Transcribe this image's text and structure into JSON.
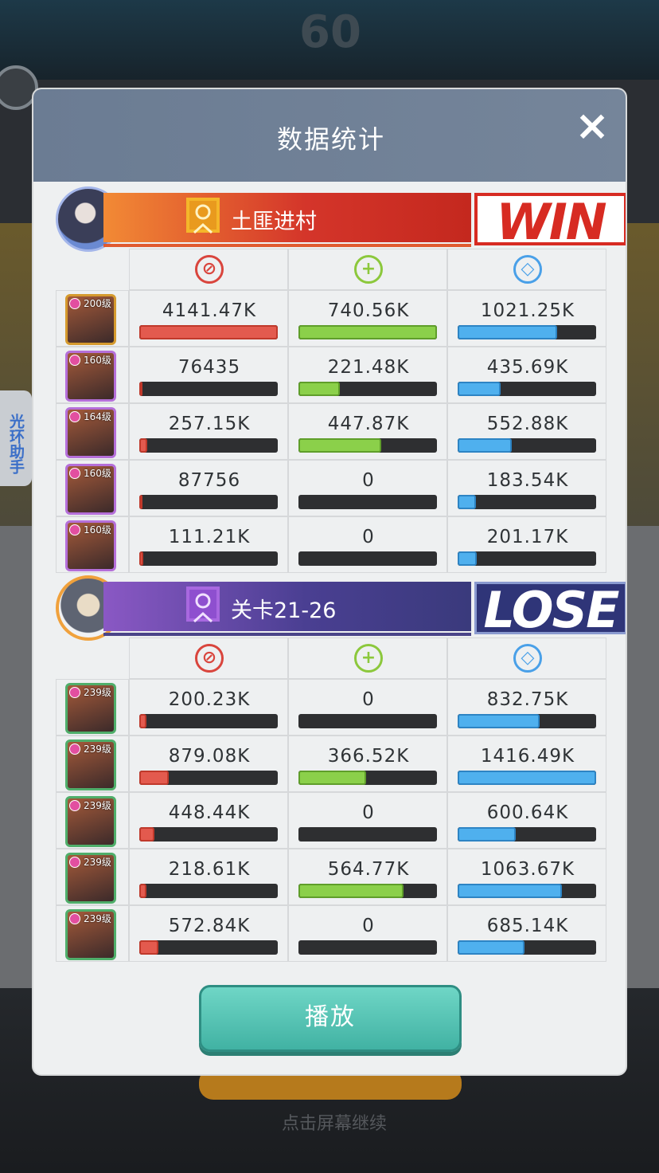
{
  "background": {
    "score": "60",
    "hint": "点击屏幕继续"
  },
  "side_tab": {
    "label": "光环助手"
  },
  "dialog": {
    "title": "数据统计",
    "close_icon": "×",
    "play_label": "播放"
  },
  "teams": [
    {
      "name": "土匪进村",
      "result": "WIN",
      "heroes": [
        {
          "level": "200级",
          "damage": "4141.47K",
          "damage_frac": 1.0,
          "heal": "740.56K",
          "heal_frac": 1.0,
          "shield": "1021.25K",
          "shield_frac": 0.72
        },
        {
          "level": "160级",
          "damage": "76435",
          "damage_frac": 0.02,
          "heal": "221.48K",
          "heal_frac": 0.3,
          "shield": "435.69K",
          "shield_frac": 0.31
        },
        {
          "level": "164级",
          "damage": "257.15K",
          "damage_frac": 0.06,
          "heal": "447.87K",
          "heal_frac": 0.6,
          "shield": "552.88K",
          "shield_frac": 0.39
        },
        {
          "level": "160级",
          "damage": "87756",
          "damage_frac": 0.02,
          "heal": "0",
          "heal_frac": 0,
          "shield": "183.54K",
          "shield_frac": 0.13
        },
        {
          "level": "160级",
          "damage": "111.21K",
          "damage_frac": 0.03,
          "heal": "0",
          "heal_frac": 0,
          "shield": "201.17K",
          "shield_frac": 0.14
        }
      ]
    },
    {
      "name": "关卡21-26",
      "result": "LOSE",
      "heroes": [
        {
          "level": "239级",
          "damage": "200.23K",
          "damage_frac": 0.05,
          "heal": "0",
          "heal_frac": 0,
          "shield": "832.75K",
          "shield_frac": 0.59
        },
        {
          "level": "239级",
          "damage": "879.08K",
          "damage_frac": 0.21,
          "heal": "366.52K",
          "heal_frac": 0.49,
          "shield": "1416.49K",
          "shield_frac": 1.0
        },
        {
          "level": "239级",
          "damage": "448.44K",
          "damage_frac": 0.11,
          "heal": "0",
          "heal_frac": 0,
          "shield": "600.64K",
          "shield_frac": 0.42
        },
        {
          "level": "239级",
          "damage": "218.61K",
          "damage_frac": 0.05,
          "heal": "564.77K",
          "heal_frac": 0.76,
          "shield": "1063.67K",
          "shield_frac": 0.75
        },
        {
          "level": "239级",
          "damage": "572.84K",
          "damage_frac": 0.14,
          "heal": "0",
          "heal_frac": 0,
          "shield": "685.14K",
          "shield_frac": 0.48
        }
      ]
    }
  ],
  "icons": {
    "damage": "sword-icon",
    "heal": "plus-icon",
    "shield": "shield-icon"
  }
}
